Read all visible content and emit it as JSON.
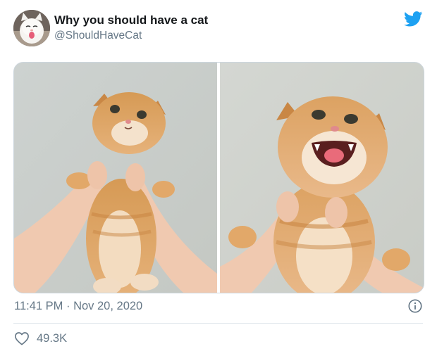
{
  "tweet": {
    "display_name": "Why you should have a cat",
    "handle": "@ShouldHaveCat",
    "timestamp": "11:41 PM · Nov 20, 2020",
    "like_count": "49.3K"
  },
  "icons": {
    "brand": "twitter-bird-icon",
    "info": "info-icon",
    "like": "heart-icon"
  },
  "colors": {
    "twitter_blue": "#1da1f2",
    "secondary_text": "#657786",
    "border": "#ccd6dd"
  }
}
